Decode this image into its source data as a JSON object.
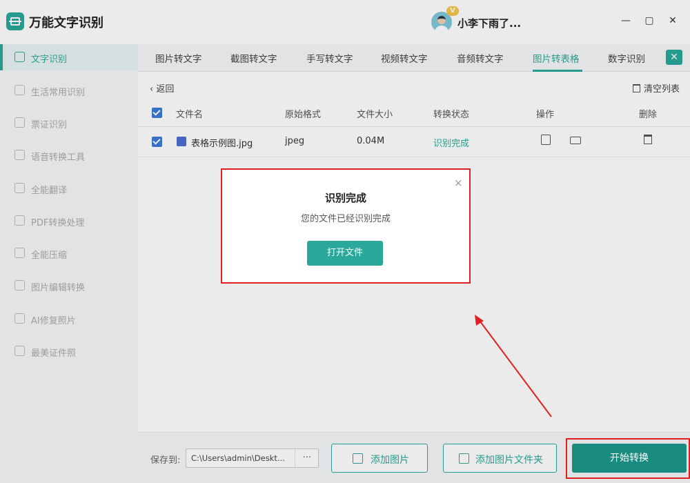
{
  "app": {
    "title": "万能文字识别"
  },
  "user": {
    "name": "小李下雨了...",
    "badge": "V"
  },
  "window": {
    "minimize": "—",
    "maximize": "▢",
    "close": "✕"
  },
  "sidebar": {
    "items": [
      {
        "label": "文字识别",
        "active": true
      },
      {
        "label": "生活常用识别"
      },
      {
        "label": "票证识别"
      },
      {
        "label": "语音转换工具"
      },
      {
        "label": "全能翻译"
      },
      {
        "label": "PDF转换处理"
      },
      {
        "label": "全能压缩"
      },
      {
        "label": "图片编辑转换"
      },
      {
        "label": "AI修复照片"
      },
      {
        "label": "最美证件照"
      }
    ]
  },
  "tabs": [
    {
      "label": "图片转文字"
    },
    {
      "label": "截图转文字"
    },
    {
      "label": "手写转文字"
    },
    {
      "label": "视频转文字"
    },
    {
      "label": "音频转文字"
    },
    {
      "label": "图片转表格",
      "active": true
    },
    {
      "label": "数字识别"
    }
  ],
  "toolbar": {
    "back": "返回",
    "clear": "清空列表"
  },
  "table": {
    "headers": [
      "文件名",
      "原始格式",
      "文件大小",
      "转换状态",
      "操作",
      "删除"
    ],
    "rows": [
      {
        "name": "表格示例图.jpg",
        "format": "jpeg",
        "size": "0.04M",
        "status": "识别完成"
      }
    ]
  },
  "modal": {
    "title": "识别完成",
    "message": "您的文件已经识别完成",
    "button": "打开文件",
    "close": "×"
  },
  "footer": {
    "save_label": "保存到:",
    "path": "C:\\Users\\admin\\Deskt...",
    "more": "···",
    "add_image": "添加图片",
    "add_folder": "添加图片文件夹",
    "start": "开始转换"
  },
  "colors": {
    "accent": "#2aa99a",
    "annotation": "#e02020",
    "primary": "#1a8b7f"
  }
}
